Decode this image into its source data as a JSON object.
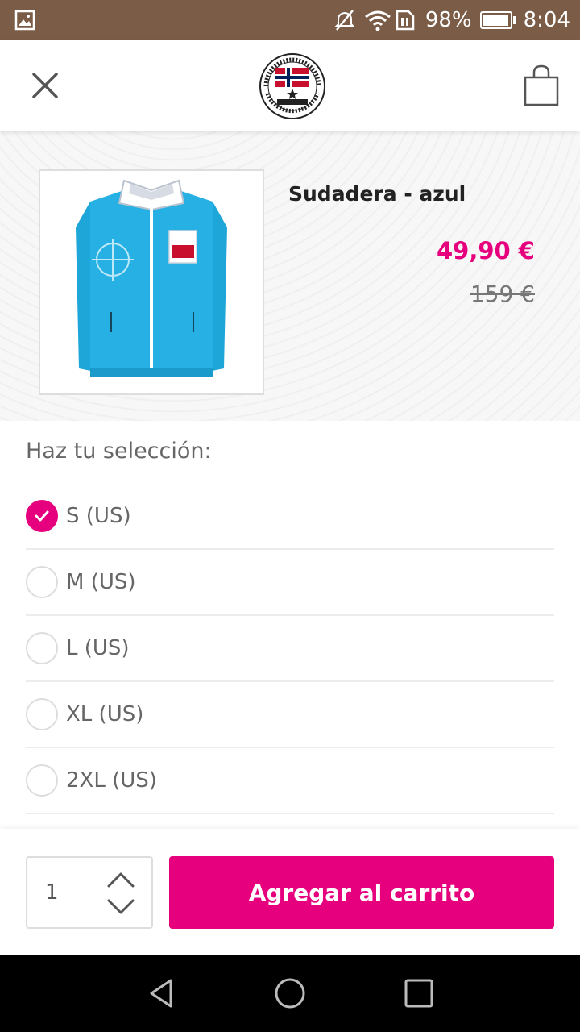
{
  "status_bar": {
    "battery": "98%",
    "time": "8:04",
    "battery_level": 0.98,
    "icons": [
      "image-icon",
      "mute-icon",
      "wifi-icon",
      "sim-icon",
      "battery-icon"
    ]
  },
  "header": {
    "close_icon": "close-icon",
    "logo": "nebulus-logo",
    "cart_icon": "shopping-bag-icon"
  },
  "product": {
    "title": "Sudadera - azul",
    "price": "49,90 €",
    "old_price": "159 €",
    "image": "blue-jacket-image"
  },
  "selection": {
    "heading": "Haz tu selección:",
    "options": [
      {
        "label": "S (US)",
        "selected": true
      },
      {
        "label": "M (US)",
        "selected": false
      },
      {
        "label": "L (US)",
        "selected": false
      },
      {
        "label": "XL (US)",
        "selected": false
      },
      {
        "label": "2XL (US)",
        "selected": false
      }
    ]
  },
  "quantity": {
    "value": "1"
  },
  "add_to_cart": {
    "label": "Agregar al carrito"
  },
  "colors": {
    "accent": "#e6007e",
    "status_bar": "#7a5c47"
  }
}
